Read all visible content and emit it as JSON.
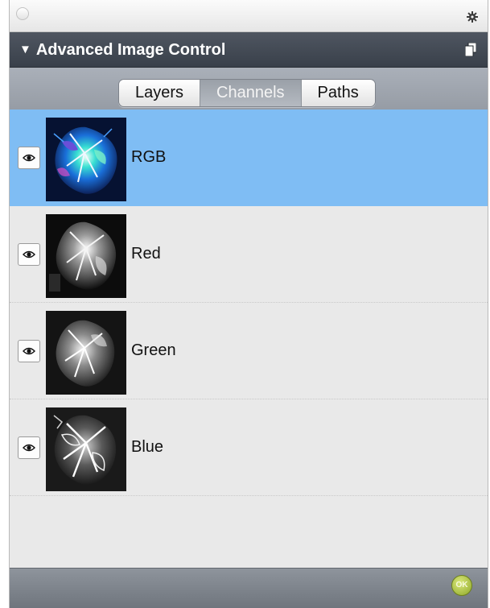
{
  "window": {
    "panel_title": "Advanced Image Control"
  },
  "tabs": [
    {
      "label": "Layers",
      "active": false
    },
    {
      "label": "Channels",
      "active": true
    },
    {
      "label": "Paths",
      "active": false
    }
  ],
  "channels": [
    {
      "label": "RGB",
      "visible": true,
      "selected": true
    },
    {
      "label": "Red",
      "visible": true,
      "selected": false
    },
    {
      "label": "Green",
      "visible": true,
      "selected": false
    },
    {
      "label": "Blue",
      "visible": true,
      "selected": false
    }
  ],
  "footer": {
    "ok_label": "OK"
  },
  "colors": {
    "selection": "#7fbdf4",
    "header_dark": "#3f4650",
    "ok_green": "#a3b934"
  },
  "icons": {
    "close": "close-circle-icon",
    "settings": "gear-icon",
    "panel_menu": "panel-menu-icon",
    "collapse": "disclosure-triangle-icon",
    "visibility": "eye-icon"
  }
}
